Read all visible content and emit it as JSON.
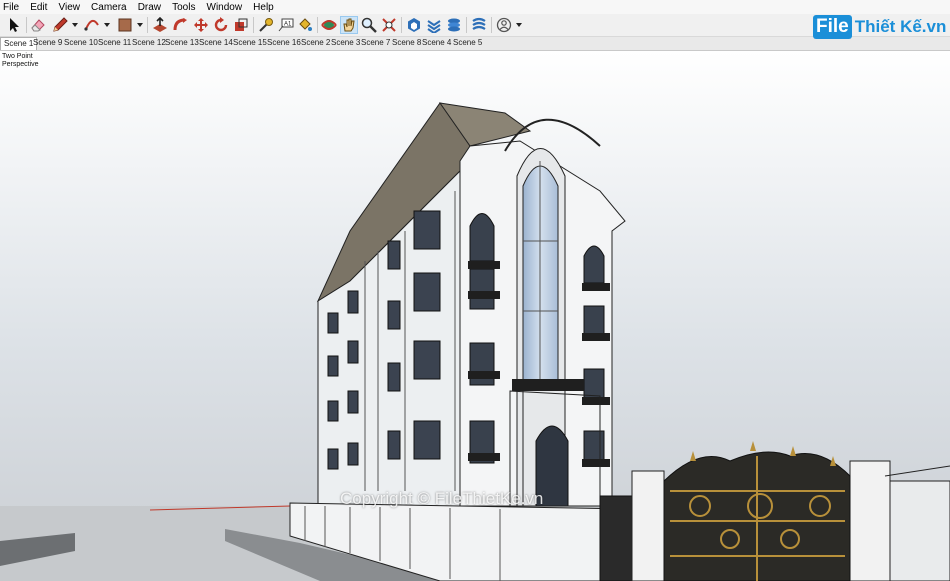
{
  "menu": [
    "File",
    "Edit",
    "View",
    "Camera",
    "Draw",
    "Tools",
    "Window",
    "Help"
  ],
  "scenes": [
    "Scene 1",
    "Scene 9",
    "Scene 10",
    "Scene 11",
    "Scene 12",
    "Scene 13",
    "Scene 14",
    "Scene 15",
    "Scene 16",
    "Scene 2",
    "Scene 3",
    "Scene 7",
    "Scene 8",
    "Scene 4",
    "Scene 5"
  ],
  "active_scene": "Scene 1",
  "camera_label": "Two Point Perspective",
  "logo": {
    "mark": "File",
    "text": "Thiết Kế.vn"
  },
  "watermark": "Copyright © FileThietKe.vn",
  "toolbar": {
    "tools": [
      "select-tool",
      "eraser-tool",
      "pencil-line-tool",
      "arc-tool",
      "rectangle-tool",
      "push-pull-tool",
      "follow-me-tool",
      "move-tool",
      "rotate-tool",
      "scale-tool",
      "tape-measure-tool",
      "text-tool",
      "paint-bucket-tool",
      "orbit-tool",
      "pan-tool",
      "zoom-tool",
      "zoom-extents-tool",
      "warehouse-tool",
      "extension-tool",
      "extension-warehouse-tool",
      "sandbox-tool",
      "account-tool"
    ]
  }
}
